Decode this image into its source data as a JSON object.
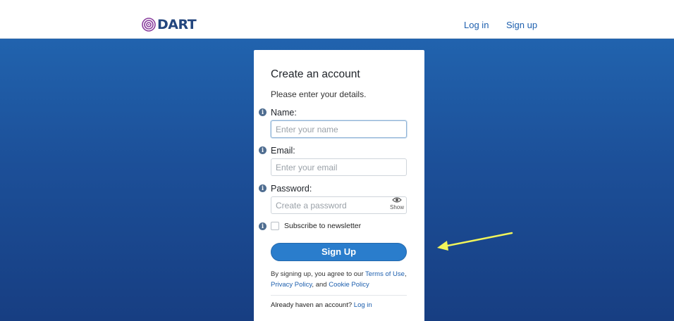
{
  "header": {
    "logo_text": "DART",
    "nav": {
      "login": "Log in",
      "signup": "Sign up"
    }
  },
  "form": {
    "title": "Create an account",
    "subtitle": "Please enter your details.",
    "fields": {
      "name": {
        "label": "Name:",
        "placeholder": "Enter your name",
        "value": ""
      },
      "email": {
        "label": "Email:",
        "placeholder": "Enter your email",
        "value": ""
      },
      "password": {
        "label": "Password:",
        "placeholder": "Create a password",
        "value": "",
        "toggle_label": "Show"
      }
    },
    "newsletter": {
      "label": "Subscribe to newsletter",
      "checked": false
    },
    "submit_label": "Sign Up",
    "legal": {
      "prefix": "By signing up, you agree to our ",
      "terms": "Terms of Use",
      "comma": ",",
      "privacy": "Privacy Policy",
      "and": ", and ",
      "cookie": "Cookie Policy"
    },
    "already": {
      "text": "Already haven an account? ",
      "link": "Log in"
    }
  },
  "colors": {
    "brand": "#23467e",
    "link": "#1d5fae",
    "button": "#2a7dcc",
    "hero_top": "#2163ae",
    "hero_bottom": "#173e82",
    "annotation_arrow": "#f2f55a"
  },
  "icons": [
    "dart-target-icon",
    "info-icon",
    "eye-icon",
    "arrow-annotation-icon"
  ]
}
